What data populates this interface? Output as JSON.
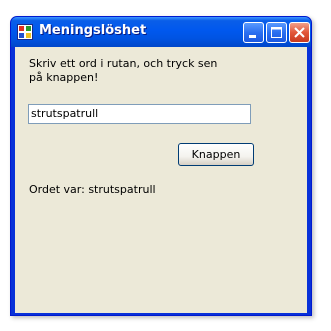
{
  "window": {
    "title": "Meningslöshet",
    "icon": "app-window-icon",
    "controls": {
      "minimize": "minimize-icon",
      "maximize": "maximize-icon",
      "close": "close-icon"
    }
  },
  "form": {
    "instruction": "Skriv ett ord i rutan, och tryck sen på knappen!",
    "input_value": "strutspatrull",
    "button_label": "Knappen",
    "result_text": "Ordet var: strutspatrull"
  },
  "colors": {
    "titlebar": "#0054e3",
    "client_background": "#ece9d8",
    "close_button": "#e2573a"
  }
}
